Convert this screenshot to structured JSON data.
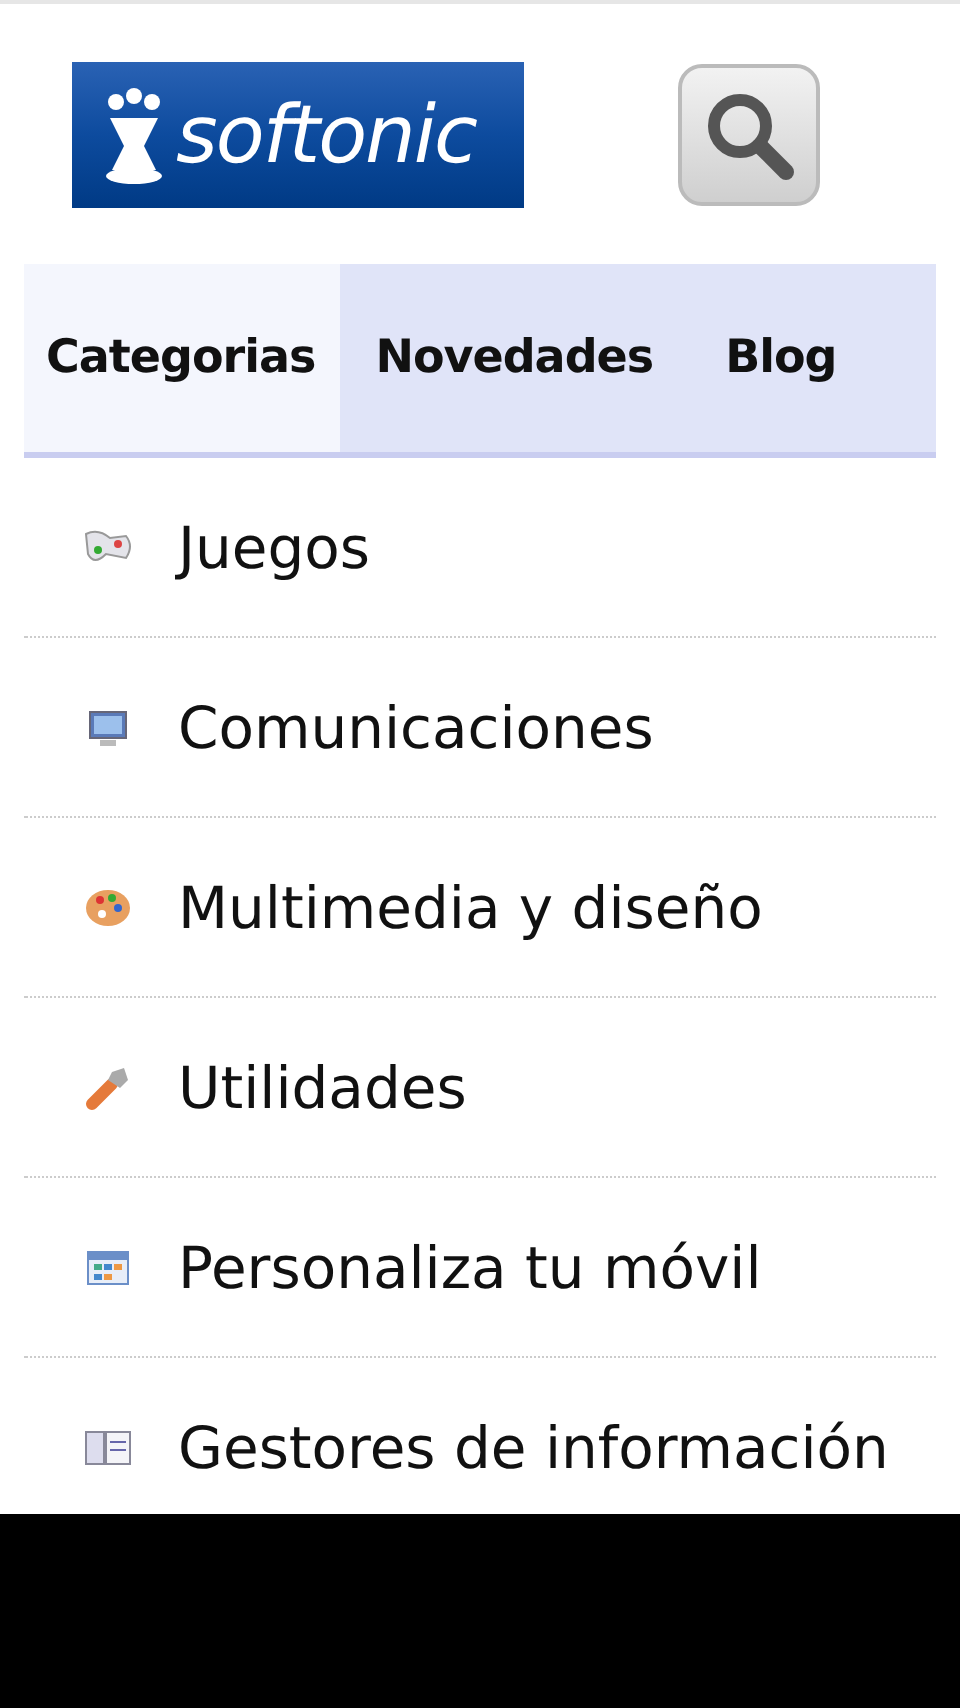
{
  "header": {
    "logo": "softonic"
  },
  "tabs": [
    {
      "label": "Categorias",
      "selected": true
    },
    {
      "label": "Novedades",
      "selected": false
    },
    {
      "label": "Blog",
      "selected": false
    }
  ],
  "categories": [
    {
      "label": "Juegos"
    },
    {
      "label": "Comunicaciones"
    },
    {
      "label": "Multimedia y diseño"
    },
    {
      "label": "Utilidades"
    },
    {
      "label": "Personaliza tu móvil"
    },
    {
      "label": "Gestores de información"
    }
  ]
}
